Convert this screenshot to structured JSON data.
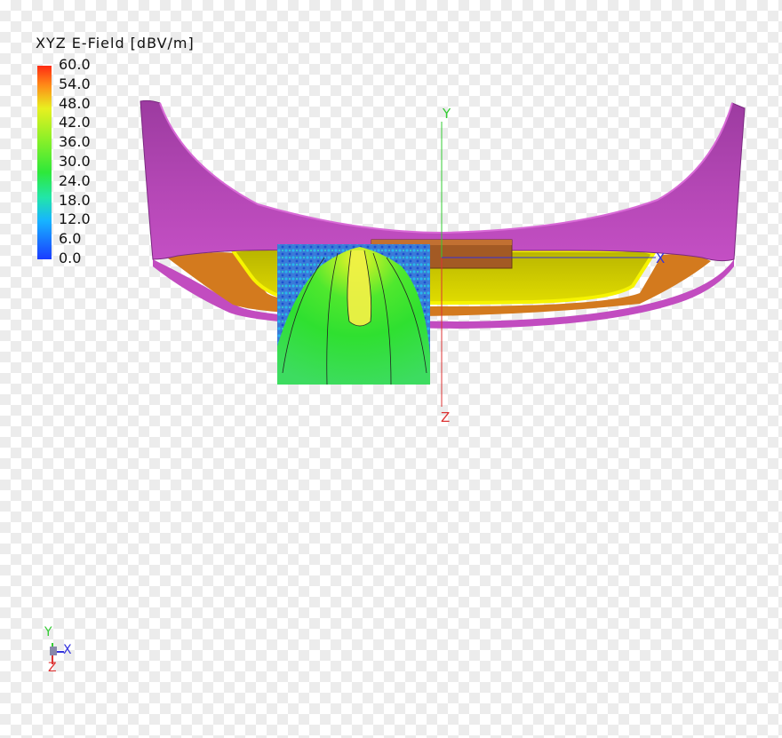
{
  "legend": {
    "title": "XYZ E-Field [dBV/m]",
    "ticks": [
      "60.0",
      "54.0",
      "48.0",
      "42.0",
      "36.0",
      "30.0",
      "24.0",
      "18.0",
      "12.0",
      "6.0",
      "0.0"
    ]
  },
  "axes": {
    "y_label": "Y",
    "x_label": "X",
    "z_label": "Z"
  },
  "triad": {
    "y_label": "Y",
    "x_label": "X",
    "z_label": "Z"
  },
  "colors": {
    "shell": "#c944c4",
    "shell_dark": "#8c2d8c",
    "yellow": "#f0f000",
    "orange": "#d37a1e",
    "brown": "#a35a24",
    "axis_green": "#33cc33",
    "axis_blue": "#3333dd",
    "axis_red": "#dd3333"
  }
}
